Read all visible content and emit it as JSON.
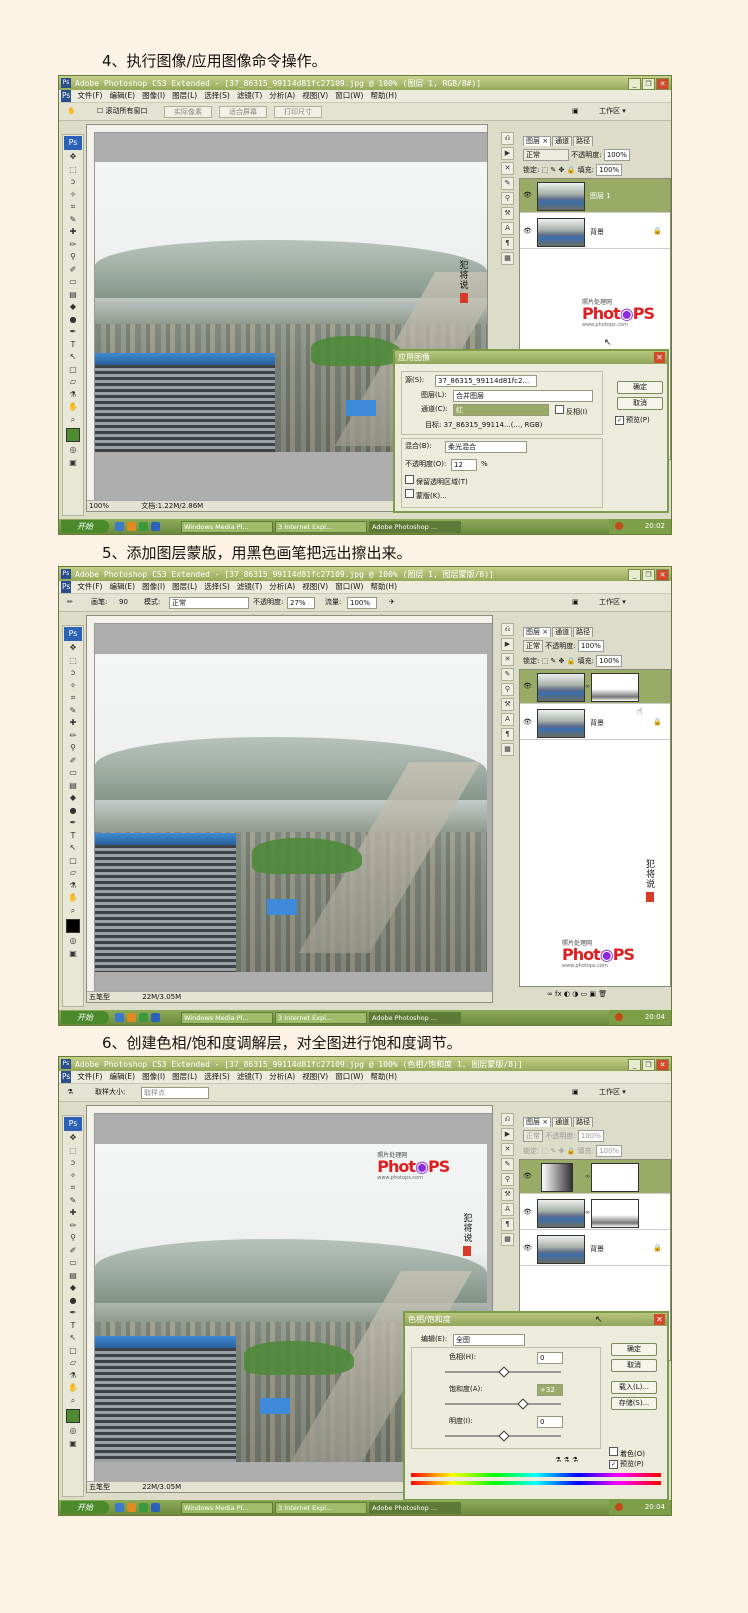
{
  "captions": [
    "4、执行图像/应用图像命令操作。",
    "5、添加图层蒙版，用黑色画笔把远出擦出来。",
    "6、创建色相/饱和度调解层，对全图进行饱和度调节。"
  ],
  "app": {
    "ps_badge": "Ps",
    "menu": [
      "文件(F)",
      "编辑(E)",
      "图像(I)",
      "图层(L)",
      "选择(S)",
      "滤镜(T)",
      "分析(A)",
      "视图(V)",
      "窗口(W)",
      "帮助(H)"
    ],
    "workspace": "工作区 ▾",
    "window_buttons": [
      "_",
      "❐",
      "✕"
    ]
  },
  "shots": [
    {
      "title": "Adobe Photoshop CS3 Extended - [37_86315_99114d81fc27109.jpg @ 100% (图层 1, RGB/8#)]",
      "options": {
        "scroll_all": "滚动所有窗口",
        "btn1": "实际像素",
        "btn2": "适合屏幕",
        "btn3": "打印尺寸"
      },
      "doc_status": "100%",
      "doc_size": "文档:1.22M/2.86M",
      "layers": {
        "tabs": [
          "图层 ×",
          "通道",
          "路径"
        ],
        "blend": "正常",
        "opacity_label": "不透明度:",
        "opacity": "100%",
        "lock_label": "锁定:",
        "fill_label": "填充:",
        "fill": "100%",
        "rows": [
          {
            "name": "图层 1"
          },
          {
            "name": "背景"
          }
        ]
      },
      "logo": {
        "small": "照片处理网",
        "url": "www.photops.com"
      },
      "dialog": {
        "title": "应用图像",
        "source_label": "源(S):",
        "source": "37_86315_99114d81fc2...",
        "layer_label": "图层(L):",
        "layer": "合并图层",
        "channel_label": "通道(C):",
        "channel": "红",
        "invert": "反相(I)",
        "target": "目标:   37_86315_99114...(..., RGB)",
        "blend_label": "混合(B):",
        "blend": "柔光混合",
        "opacity_label": "不透明度(O):",
        "opacity": "12",
        "percent": "%",
        "preserve": "保留透明区域(T)",
        "mask": "蒙版(K)...",
        "ok": "确定",
        "cancel": "取消",
        "preview": "预览(P)"
      },
      "taskbar": {
        "start": "开始",
        "tasks": [
          "Windows Media Pl...",
          "3 Internet Expl...",
          "Adobe Photoshop ..."
        ],
        "time": "20:02"
      }
    },
    {
      "title": "Adobe Photoshop CS3 Extended - [37_86315_99114d81fc27109.jpg @ 100% (图层 1, 图层蒙版/8)]",
      "options": {
        "brush_label": "画笔:",
        "brush_size": "90",
        "mode_label": "模式:",
        "mode": "正常",
        "opacity_label": "不透明度:",
        "opacity": "27%",
        "flow_label": "流量:",
        "flow": "100%"
      },
      "doc_status": "五笔型",
      "doc_size": "22M/3.05M",
      "layers": {
        "tabs": [
          "图层 ×",
          "通道",
          "路径"
        ],
        "blend": "正常",
        "opacity_label": "不透明度:",
        "opacity": "100%",
        "lock_label": "锁定:",
        "fill_label": "填充:",
        "fill": "100%",
        "rows": [
          {
            "name": ""
          },
          {
            "name": "背景"
          }
        ]
      },
      "logo": {
        "small": "照片处理网",
        "url": "www.photops.com"
      },
      "taskbar": {
        "start": "开始",
        "tasks": [
          "Windows Media Pl...",
          "3 Internet Expl...",
          "Adobe Photoshop ..."
        ],
        "time": "20:04"
      }
    },
    {
      "title": "Adobe Photoshop CS3 Extended - [37_86315_99114d81fc27109.jpg @ 100% (色相/饱和度 1, 图层蒙版/8)]",
      "options": {
        "sample_label": "取样大小:",
        "sample": "取样点"
      },
      "doc_status": "五笔型",
      "doc_size": "22M/3.05M",
      "layers": {
        "tabs": [
          "图层 ×",
          "通道",
          "路径"
        ],
        "blend": "正常",
        "opacity_label": "不透明度:",
        "opacity": "100%",
        "lock_label": "锁定:",
        "fill_label": "填充:",
        "fill": "100%",
        "rows": [
          {
            "name": ""
          },
          {
            "name": ""
          },
          {
            "name": "背景"
          }
        ]
      },
      "logo": {
        "small": "照片处理网",
        "url": "www.photops.com"
      },
      "dialog": {
        "title": "色相/饱和度",
        "edit_label": "编辑(E):",
        "edit": "全图",
        "hue_label": "色相(H):",
        "hue": "0",
        "sat_label": "饱和度(A):",
        "sat": "+32",
        "light_label": "明度(I):",
        "light": "0",
        "ok": "确定",
        "cancel": "取消",
        "load": "载入(L)...",
        "save": "存储(S)...",
        "colorize": "着色(O)",
        "preview": "预览(P)"
      },
      "taskbar": {
        "start": "开始",
        "tasks": [
          "Windows Media Pl...",
          "3 Internet Expl...",
          "Adobe Photoshop ..."
        ],
        "time": "20:04"
      }
    }
  ],
  "logo_text": {
    "a": "Phot",
    "b": "PS"
  },
  "stamp_text": "犯将说"
}
